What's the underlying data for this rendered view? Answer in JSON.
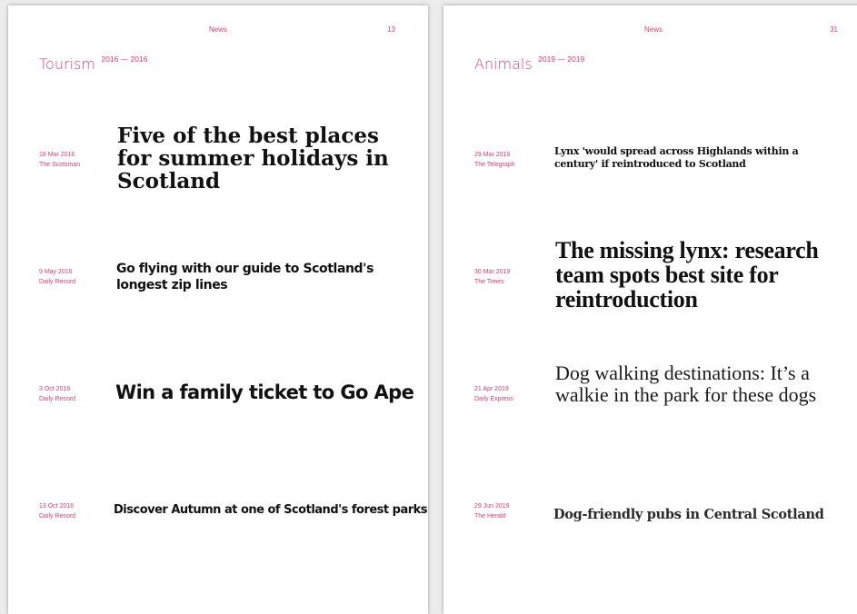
{
  "pages": [
    {
      "running_title": "News",
      "page_number": "13",
      "section": {
        "title": "Tourism",
        "range": "2016 — 2016"
      },
      "entries": [
        {
          "date": "18 Mar 2016",
          "source": "The Scotsman",
          "headline": "Five of the best places for summer holidays in Scotland"
        },
        {
          "date": "9 May 2016",
          "source": "Daily Record",
          "headline": "Go flying with our guide to Scotland's longest zip lines"
        },
        {
          "date": "3 Oct 2016",
          "source": "Daily Record",
          "headline": "Win a family ticket to Go Ape"
        },
        {
          "date": "13 Oct 2016",
          "source": "Daily Record",
          "headline": "Discover Autumn at one of Scotland's forest parks"
        }
      ]
    },
    {
      "running_title": "News",
      "page_number": "31",
      "section": {
        "title": "Animals",
        "range": "2019 — 2019"
      },
      "entries": [
        {
          "date": "29 Mar 2019",
          "source": "The Telegraph",
          "headline": "Lynx 'would spread across Highlands within a century' if reintroduced to Scotland"
        },
        {
          "date": "30 Mar 2019",
          "source": "The Times",
          "headline": "The missing lynx: research team spots best site for reintroduction"
        },
        {
          "date": "21 Apr 2019",
          "source": "Daily Express",
          "headline": "Dog walking destinations: It’s a walkie in the park for these dogs"
        },
        {
          "date": "29 Jun 2019",
          "source": "The Herald",
          "headline": "Dog-friendly pubs in Central Scotland"
        }
      ]
    }
  ]
}
